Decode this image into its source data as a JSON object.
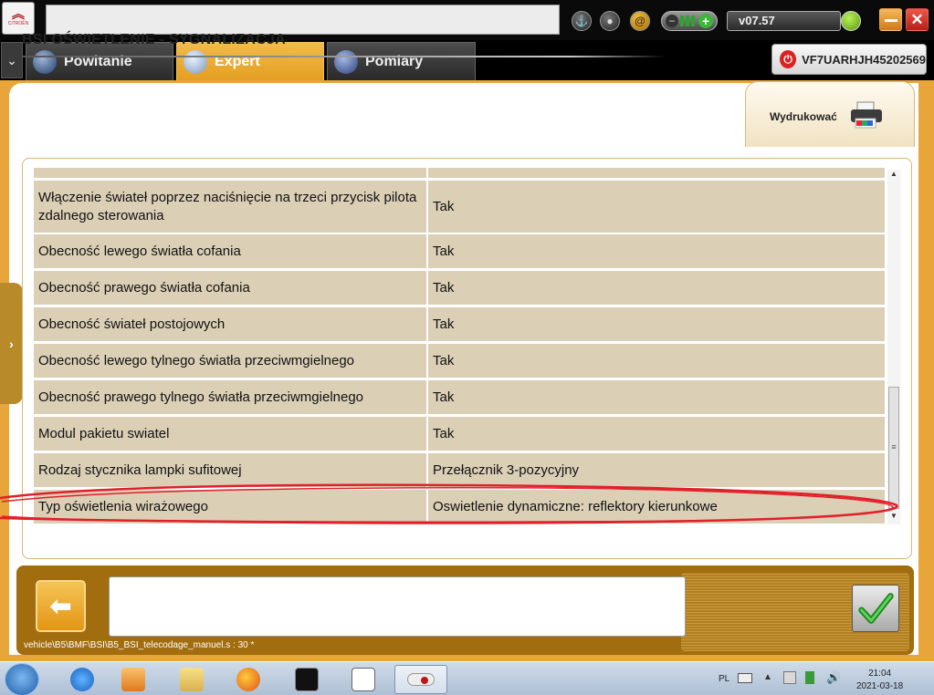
{
  "app": {
    "brand": "CITROËN",
    "version": "v07.57"
  },
  "tabs": [
    {
      "label": "Powitanie"
    },
    {
      "label": "Expert"
    },
    {
      "label": "Pomiary"
    }
  ],
  "vin": "VF7UARHJH45202569",
  "page": {
    "title": "BSI  OŚWIETLENIE - SYGNALIZACJA",
    "print_label": "Wydrukować"
  },
  "table": {
    "rows": [
      {
        "param": "",
        "value": ""
      },
      {
        "param": "Włączenie świateł poprzez naciśnięcie na trzeci przycisk pilota zdalnego sterowania",
        "value": "Tak"
      },
      {
        "param": "Obecność lewego światła cofania",
        "value": "Tak"
      },
      {
        "param": "Obecność prawego światła cofania",
        "value": "Tak"
      },
      {
        "param": "Obecność świateł postojowych",
        "value": "Tak"
      },
      {
        "param": "Obecność lewego tylnego światła przeciwmgielnego",
        "value": "Tak"
      },
      {
        "param": "Obecność prawego tylnego światła przeciwmgielnego",
        "value": "Tak"
      },
      {
        "param": "Modul pakietu swiatel",
        "value": "Tak"
      },
      {
        "param": "Rodzaj stycznika lampki sufitowej",
        "value": "Przełącznik 3-pozycyjny"
      },
      {
        "param": "Typ oświetlenia wirażowego",
        "value": "Oswietlenie dynamiczne: reflektory kierunkowe"
      }
    ]
  },
  "footer": {
    "path": "vehicle\\B5\\BMF\\BSI\\B5_BSI_telecodage_manuel.s : 30 *"
  },
  "taskbar": {
    "lang": "PL",
    "time": "21:04",
    "date": "2021-03-18"
  },
  "colors": {
    "accent": "#e8a53a",
    "row_bg": "#dbcfb6",
    "highlight": "#e0202a"
  }
}
